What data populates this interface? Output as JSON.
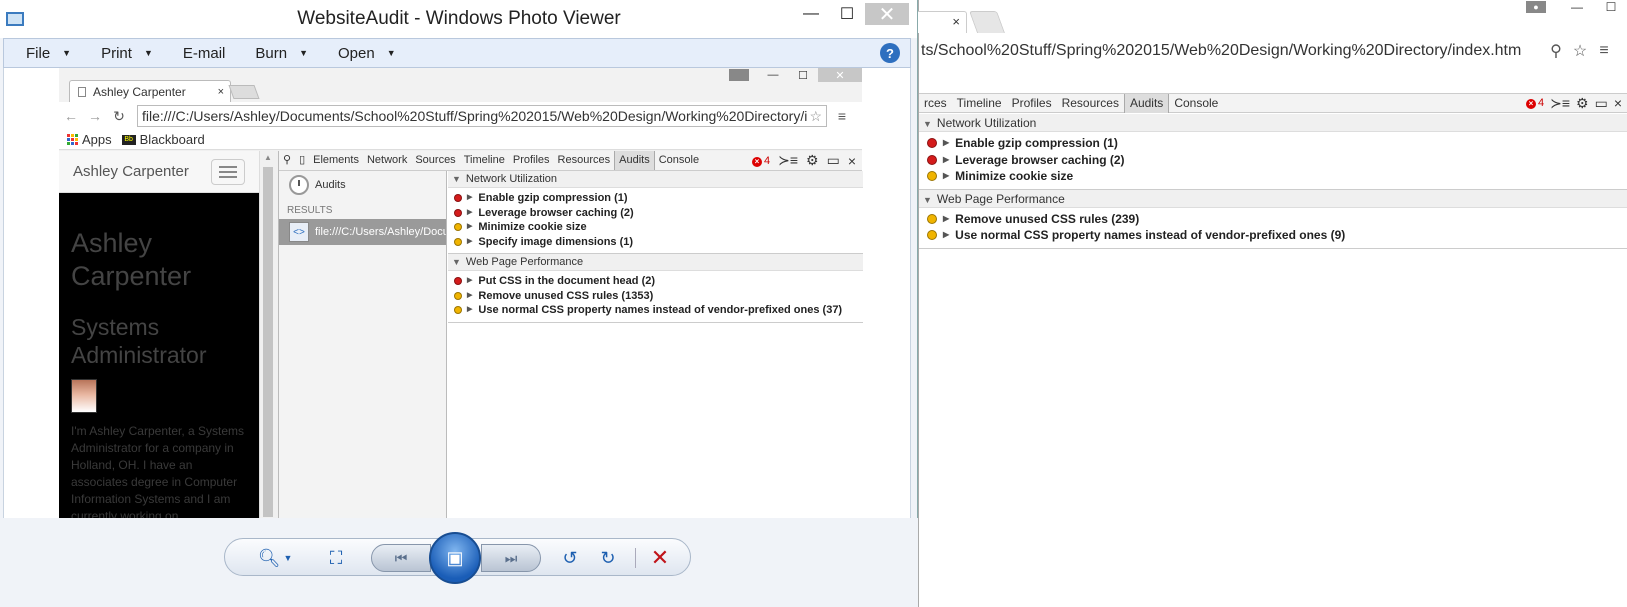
{
  "background_browser": {
    "tab_close": "×",
    "url": "ts/School%20Stuff/Spring%202015/Web%20Design/Working%20Directory/index.htm",
    "devtools_tabs": [
      "rces",
      "Timeline",
      "Profiles",
      "Resources",
      "Audits",
      "Console"
    ],
    "active_tab": "Audits",
    "error_count": "4",
    "groups": [
      {
        "title": "Network Utilization",
        "rows": [
          {
            "label": "Enable gzip compression (1)",
            "severity": "red"
          },
          {
            "label": "Leverage browser caching (2)",
            "severity": "red"
          },
          {
            "label": "Minimize cookie size",
            "severity": "yellow"
          }
        ]
      },
      {
        "title": "Web Page Performance",
        "rows": [
          {
            "label": "Remove unused CSS rules (239)",
            "severity": "yellow"
          },
          {
            "label": "Use normal CSS property names instead of vendor-prefixed ones (9)",
            "severity": "yellow"
          }
        ]
      }
    ]
  },
  "photo_viewer": {
    "title": "WebsiteAudit - Windows Photo Viewer",
    "menu": [
      {
        "label": "File",
        "dropdown": true
      },
      {
        "label": "Print",
        "dropdown": true
      },
      {
        "label": "E-mail",
        "dropdown": false
      },
      {
        "label": "Burn",
        "dropdown": true
      },
      {
        "label": "Open",
        "dropdown": true
      }
    ],
    "help_label": "?"
  },
  "inner_browser": {
    "tab_title": "Ashley Carpenter",
    "tab_close": "×",
    "url": "file:///C:/Users/Ashley/Documents/School%20Stuff/Spring%202015/Web%20Design/Working%20Directory/i",
    "bookmarks": [
      "Apps",
      "Blackboard"
    ],
    "page": {
      "brand": "Ashley Carpenter",
      "hero_name": "Ashley Carpenter",
      "hero_role": "Systems Administrator",
      "bio": "I'm Ashley Carpenter, a Systems Administrator for a company in Holland, OH. I have an associates degree in Computer Information Systems and I am currently working on"
    },
    "devtools_tabs": [
      "Elements",
      "Network",
      "Sources",
      "Timeline",
      "Profiles",
      "Resources",
      "Audits",
      "Console"
    ],
    "active_tab": "Audits",
    "error_count": "4",
    "sidebar": {
      "audits_label": "Audits",
      "results_label": "RESULTS",
      "result_item": "file:///C:/Users/Ashley/Documents"
    },
    "groups": [
      {
        "title": "Network Utilization",
        "rows": [
          {
            "label": "Enable gzip compression (1)",
            "severity": "red"
          },
          {
            "label": "Leverage browser caching (2)",
            "severity": "red"
          },
          {
            "label": "Minimize cookie size",
            "severity": "yellow"
          },
          {
            "label": "Specify image dimensions (1)",
            "severity": "yellow"
          }
        ]
      },
      {
        "title": "Web Page Performance",
        "rows": [
          {
            "label": "Put CSS in the document head (2)",
            "severity": "red"
          },
          {
            "label": "Remove unused CSS rules (1353)",
            "severity": "yellow"
          },
          {
            "label": "Use normal CSS property names instead of vendor-prefixed ones (37)",
            "severity": "yellow"
          }
        ]
      }
    ]
  },
  "colors": {
    "red": "#d41b1b",
    "yellow": "#f0b400",
    "accent": "#1d5fb0"
  }
}
